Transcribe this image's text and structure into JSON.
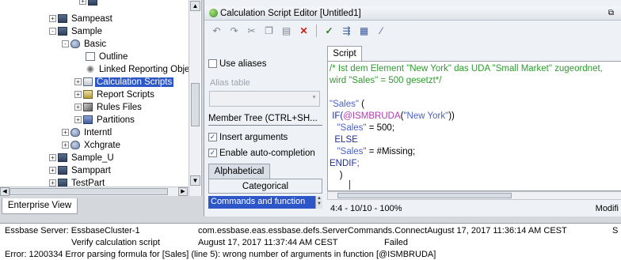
{
  "tree": {
    "cropped_top_label": "",
    "items": [
      {
        "label": "Sampeast",
        "toggle": "+",
        "icon": "server-icon"
      },
      {
        "label": "Sample",
        "toggle": "-",
        "icon": "server-icon"
      },
      {
        "label": "Basic",
        "toggle": "-",
        "icon": "database-icon"
      },
      {
        "label": "Outline",
        "toggle": "",
        "icon": "outline-icon"
      },
      {
        "label": "Linked Reporting Obje",
        "toggle": "",
        "icon": "linked-reporting-icon"
      },
      {
        "label": "Calculation Scripts",
        "toggle": "+",
        "icon": "calculation-scripts-icon"
      },
      {
        "label": "Report Scripts",
        "toggle": "+",
        "icon": "report-scripts-icon"
      },
      {
        "label": "Rules Files",
        "toggle": "+",
        "icon": "rules-files-icon"
      },
      {
        "label": "Partitions",
        "toggle": "+",
        "icon": "partitions-icon"
      },
      {
        "label": "Interntl",
        "toggle": "+",
        "icon": "database-icon"
      },
      {
        "label": "Xchgrate",
        "toggle": "+",
        "icon": "database-icon"
      },
      {
        "label": "Sample_U",
        "toggle": "+",
        "icon": "server-icon"
      },
      {
        "label": "Samppart",
        "toggle": "+",
        "icon": "server-icon"
      },
      {
        "label": "TestPart",
        "toggle": "+",
        "icon": "server-icon"
      }
    ],
    "selected": "Calculation Scripts",
    "bottom_tab": "Enterprise View"
  },
  "editor": {
    "title": "Calculation Script Editor [Untitled1]",
    "toolbar": [
      "undo-icon",
      "redo-icon",
      "cut-icon",
      "copy-icon",
      "paste-icon",
      "delete-icon",
      "validate-icon",
      "execute-icon",
      "grid-icon",
      "format-icon"
    ],
    "options": {
      "use_aliases": "Use aliases",
      "alias_table": "Alias table",
      "member_tree": "Member Tree (CTRL+SH...",
      "insert_arguments": "Insert arguments",
      "enable_autocompletion": "Enable auto-completion",
      "tab_alphabetical": "Alphabetical",
      "tab_categorical": "Categorical",
      "commands_list": "Commands and function"
    },
    "checkboxes": {
      "use_aliases": false,
      "insert_arguments": true,
      "enable_autocompletion": true
    },
    "script_tab": "Script",
    "code": {
      "line1": "/* Ist dem Element \"New York\" das UDA \"Small Market\" zugeordnet,",
      "line2": "wird \"Sales\" = 500 gesetzt*/",
      "line4a": "\"Sales\"",
      "line4b": " (",
      "line5a": " IF(",
      "line5b": "@ISMBRUDA",
      "line5c": "(",
      "line5d": "\"New York\"",
      "line5e": "))",
      "line6a": "   \"Sales\"",
      "line6b": " = 500;",
      "line7": "  ELSE",
      "line8a": "   \"Sales\"",
      "line8b": " = #Missing;",
      "line9": "ENDIF;",
      "line10": "    )"
    },
    "status_position": "4:4 - 10/10 - 100%",
    "status_mode": "Modifi"
  },
  "messages": {
    "row1_left": "Essbase Server: EssbaseCluster-1",
    "row1_mid": "com.essbase.eas.essbase.defs.ServerCommands.ConnectAugust 17, 2017 11:36:14 AM CEST",
    "row1_right": "S",
    "row2_left": "Verify calculation script",
    "row2_mid": "August 17, 2017 11:37:44 AM CEST",
    "row2_status": "Failed",
    "row3": "Error: 1200334 Error parsing formula for [Sales] (line 5): wrong number of arguments in function [@ISMBRUDA]"
  },
  "colors": {
    "selection": "#2d57c8",
    "comment": "#2e9b2e",
    "string": "#4a62c9",
    "function": "#b23ab2",
    "keyword": "#1e2f9c"
  }
}
